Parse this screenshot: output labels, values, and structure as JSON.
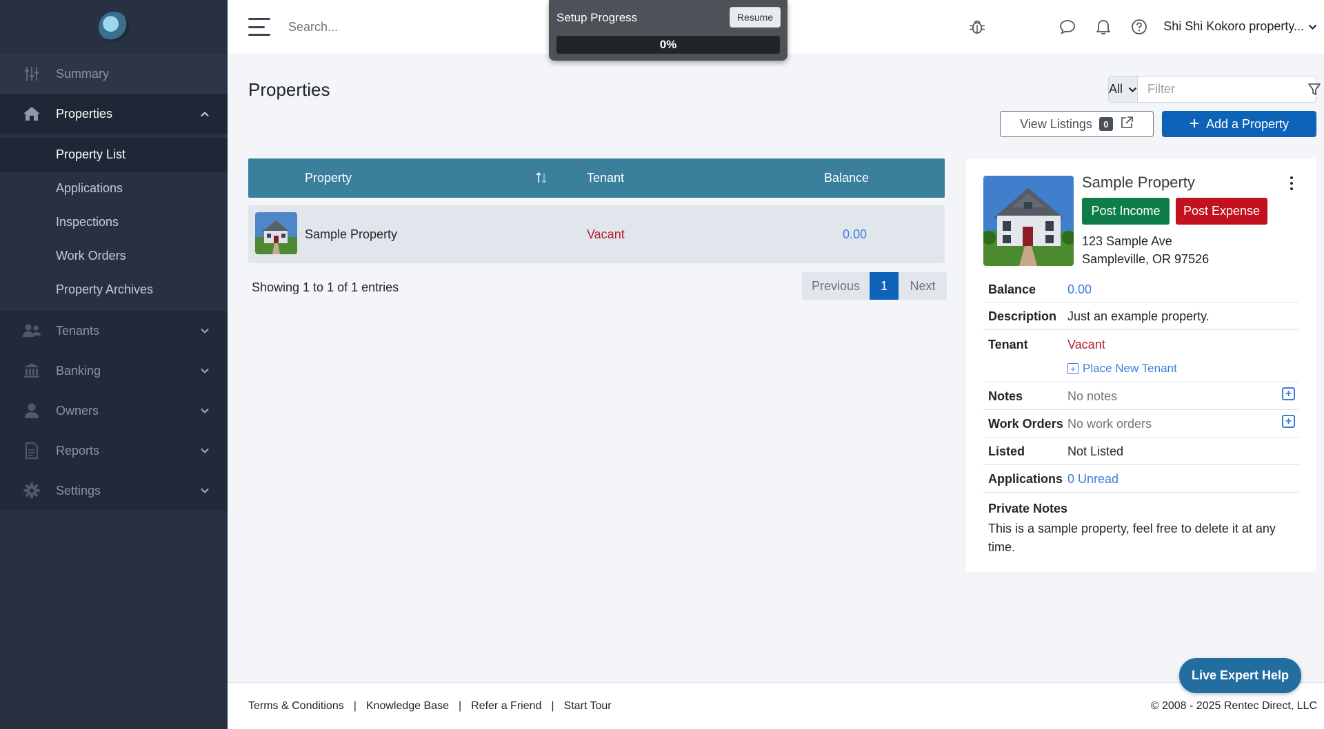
{
  "sidebar": {
    "items": [
      {
        "label": "Summary",
        "icon": "sliders-icon"
      },
      {
        "label": "Properties",
        "icon": "home-icon"
      },
      {
        "label": "Tenants",
        "icon": "users-icon"
      },
      {
        "label": "Banking",
        "icon": "bank-icon"
      },
      {
        "label": "Owners",
        "icon": "user-icon"
      },
      {
        "label": "Reports",
        "icon": "document-icon"
      },
      {
        "label": "Settings",
        "icon": "gear-icon"
      }
    ],
    "property_sub": [
      "Property List",
      "Applications",
      "Inspections",
      "Work Orders",
      "Property Archives"
    ]
  },
  "topbar": {
    "search_placeholder": "Search...",
    "account_name": "Shi Shi Kokoro property..."
  },
  "setup": {
    "title": "Setup Progress",
    "resume_label": "Resume",
    "progress_text": "0%",
    "progress_value": 0
  },
  "main": {
    "title": "Properties",
    "filter_select": "All",
    "filter_placeholder": "Filter",
    "view_listings_label": "View Listings",
    "view_listings_count": "0",
    "add_property_label": "Add a Property"
  },
  "table": {
    "headers": {
      "property": "Property",
      "tenant": "Tenant",
      "balance": "Balance"
    },
    "rows": [
      {
        "property": "Sample Property",
        "tenant": "Vacant",
        "balance": "0.00"
      }
    ],
    "entries_text": "Showing 1 to 1 of 1 entries",
    "pager": {
      "prev": "Previous",
      "current": "1",
      "next": "Next"
    }
  },
  "detail": {
    "title": "Sample Property",
    "post_income": "Post Income",
    "post_expense": "Post Expense",
    "address_line1": "123 Sample Ave",
    "address_line2": "Sampleville, OR 97526",
    "balance_label": "Balance",
    "balance_value": "0.00",
    "description_label": "Description",
    "description_value": "Just an example property.",
    "tenant_label": "Tenant",
    "tenant_value": "Vacant",
    "place_tenant": "Place New Tenant",
    "notes_label": "Notes",
    "notes_value": "No notes",
    "work_orders_label": "Work Orders",
    "work_orders_value": "No work orders",
    "listed_label": "Listed",
    "listed_value": "Not Listed",
    "applications_label": "Applications",
    "applications_value": "0 Unread",
    "private_notes_title": "Private Notes",
    "private_notes_text": "This is a sample property, feel free to delete it at any time."
  },
  "footer": {
    "links": [
      "Terms & Conditions",
      "Knowledge Base",
      "Refer a Friend",
      "Start Tour"
    ],
    "copyright": "© 2008 - 2025 Rentec Direct, LLC"
  },
  "help_button": "Live Expert Help",
  "colors": {
    "sidebar_bg": "#273142",
    "table_header": "#3a7f9c",
    "primary": "#0d63b8",
    "income": "#0f7d4a",
    "expense": "#c2121f",
    "vacant": "#b0212c",
    "link": "#3b7ddd"
  }
}
